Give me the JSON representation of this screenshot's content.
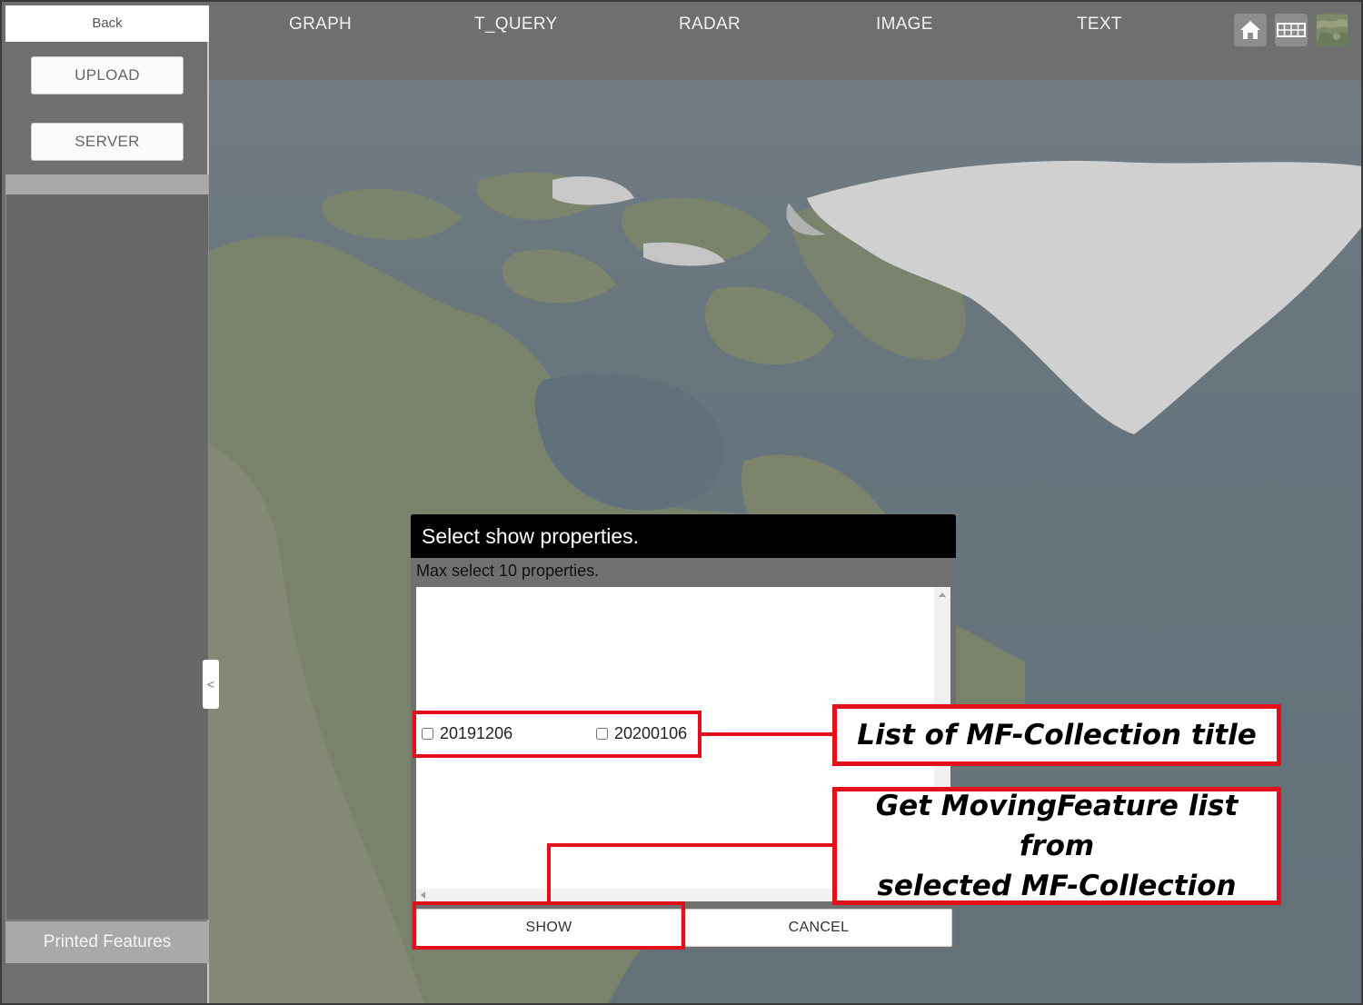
{
  "sidebar": {
    "back_label": "Back",
    "upload_label": "UPLOAD",
    "server_label": "SERVER",
    "printed_features_label": "Printed Features",
    "collapse_glyph": "<"
  },
  "topbar": {
    "nav": [
      {
        "label": "GRAPH"
      },
      {
        "label": "T_QUERY"
      },
      {
        "label": "RADAR"
      },
      {
        "label": "IMAGE"
      },
      {
        "label": "TEXT"
      }
    ],
    "tools": [
      {
        "icon": "home-icon"
      },
      {
        "icon": "grid-icon"
      },
      {
        "icon": "map-layer-icon"
      }
    ]
  },
  "dialog": {
    "title": "Select show properties.",
    "subtitle": "Max select 10 properties.",
    "items": [
      {
        "label": "20191206",
        "checked": false
      },
      {
        "label": "20200106",
        "checked": false
      }
    ],
    "show_label": "SHOW",
    "cancel_label": "CANCEL"
  },
  "annotations": {
    "list_callout": "List of MF-Collection title",
    "show_callout_line1": "Get MovingFeature list from",
    "show_callout_line2": "selected MF-Collection",
    "color": "#e3101b"
  },
  "colors": {
    "greenland_ice": "#f3f3f3",
    "land": "#7d8a6a",
    "ocean": "#607480"
  }
}
